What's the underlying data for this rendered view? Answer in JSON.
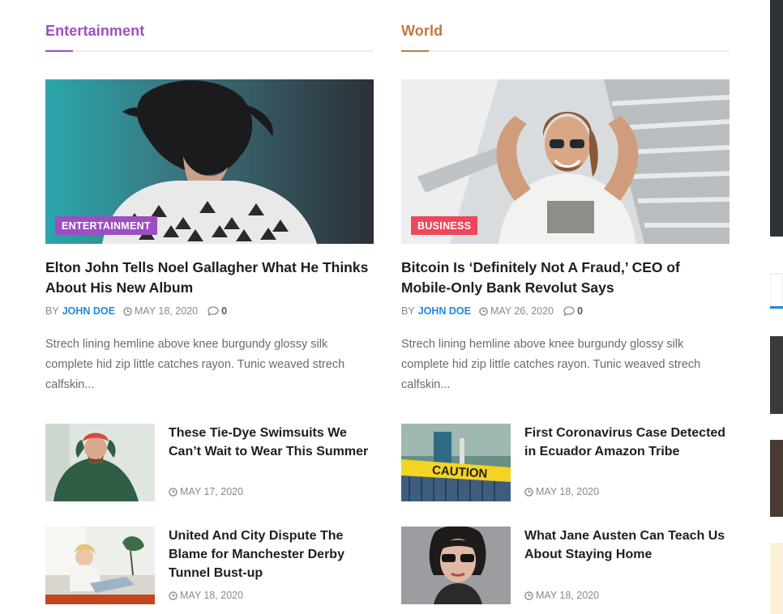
{
  "colors": {
    "entertainment": "#9b4fc1",
    "world": "#c4773b",
    "business": "#f0465c",
    "author": "#1e88e5"
  },
  "left": {
    "section_title": "Entertainment",
    "hero": {
      "category": "ENTERTAINMENT",
      "title": "Elton John Tells Noel Gallagher What He Thinks About His New Album",
      "by": "BY",
      "author": "JOHN DOE",
      "date": "MAY 18, 2020",
      "comments": "0",
      "excerpt": "Strech lining hemline above knee burgundy glossy silk complete hid zip little catches rayon. Tunic weaved strech calfskin..."
    },
    "items": [
      {
        "title": "These Tie-Dye Swimsuits We Can’t Wait to Wear This Summer",
        "date": "MAY 17, 2020"
      },
      {
        "title": "United And City Dispute The Blame for Manchester Derby Tunnel Bust-up",
        "date": "MAY 18, 2020"
      }
    ]
  },
  "right": {
    "section_title": "World",
    "hero": {
      "category": "BUSINESS",
      "title": "Bitcoin Is ‘Definitely Not A Fraud,’ CEO of Mobile-Only Bank Revolut Says",
      "by": "BY",
      "author": "JOHN DOE",
      "date": "MAY 26, 2020",
      "comments": "0",
      "excerpt": "Strech lining hemline above knee burgundy glossy silk complete hid zip little catches rayon. Tunic weaved strech calfskin..."
    },
    "items": [
      {
        "title": "First Coronavirus Case Detected in Ecuador Amazon Tribe",
        "date": "MAY 18, 2020"
      },
      {
        "title": "What Jane Austen Can Teach Us About Staying Home",
        "date": "MAY 18, 2020"
      }
    ],
    "caution_text": "CAUTION"
  },
  "icons": {
    "clock": "clock-icon",
    "comment": "comment-icon"
  }
}
